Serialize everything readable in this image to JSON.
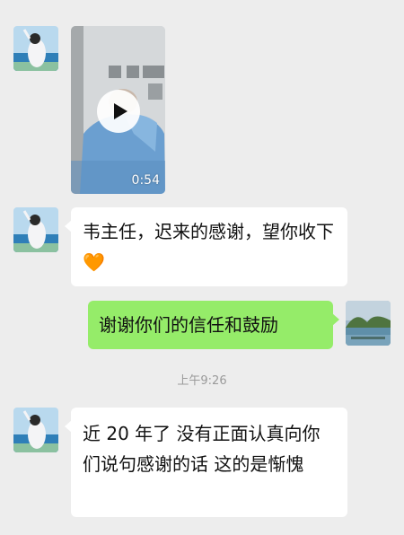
{
  "top_fragment": "",
  "messages": {
    "video": {
      "duration": "0:54"
    },
    "msg1": {
      "text": "韦主任，迟来的感谢，望你收下",
      "emoji": "heart-emoji"
    },
    "msg2": {
      "text": "谢谢你们的信任和鼓励"
    },
    "timestamp": "上午9:26",
    "msg3": {
      "text": "近 20 年了 没有正面认真向你们说句感谢的话 这的是惭愧"
    }
  },
  "colors": {
    "background": "#ededed",
    "incoming_bubble": "#ffffff",
    "outgoing_bubble": "#95ec69",
    "heart": "#f26a2e"
  }
}
